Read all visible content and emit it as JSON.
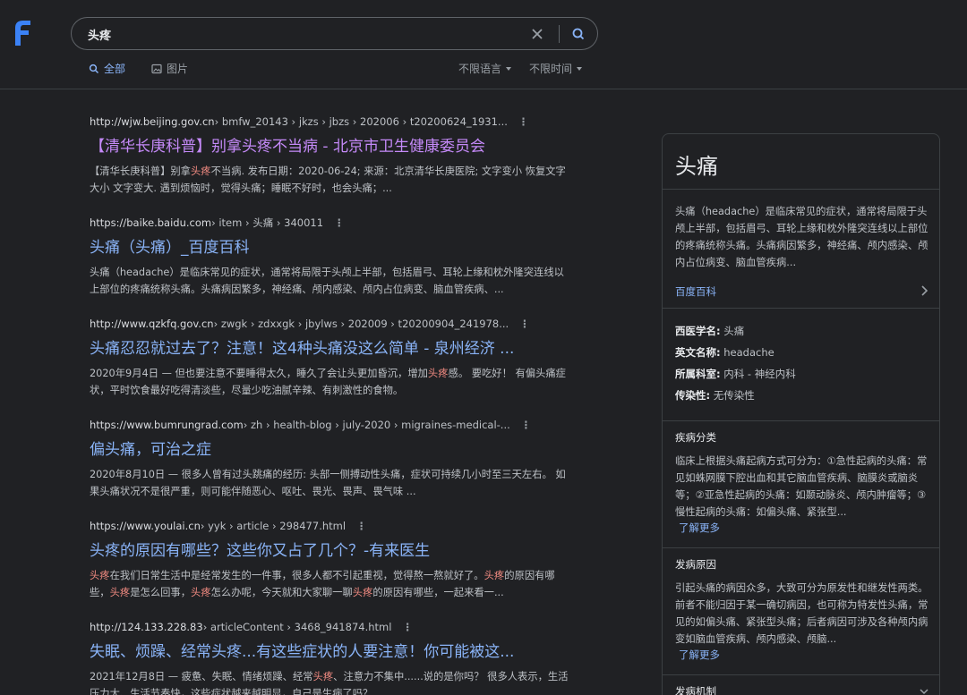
{
  "search": {
    "query": "头疼",
    "placeholder": ""
  },
  "tabs": [
    {
      "label": "全部",
      "icon": "search-icon",
      "active": true
    },
    {
      "label": "图片",
      "icon": "image-icon",
      "active": false
    }
  ],
  "filters": {
    "language": "不限语言",
    "time": "不限时间"
  },
  "colors": {
    "background": "#202124",
    "link": "#8ab4f8",
    "visited": "#c58af9",
    "highlight": "#f28b82",
    "logo": "#3b82f6"
  },
  "results": [
    {
      "host": "http://wjw.beijing.gov.cn",
      "path": " › bmfw_20143 › jkzs › jbzs › 202006 › t20200624_1931...",
      "title": "【清华长庚科普】别拿头疼不当病 - 北京市卫生健康委员会",
      "visited": true,
      "snippet": [
        {
          "t": "【清华长庚科普】别拿"
        },
        {
          "t": "头疼",
          "hl": true
        },
        {
          "t": "不当病. 发布日期：2020-06-24; 来源：北京清华长庚医院; 文字变小 恢复文字大小 文字变大. 遇到烦恼时，觉得头痛；睡眠不好时，也会头痛；..."
        }
      ]
    },
    {
      "host": "https://baike.baidu.com",
      "path": " › item › 头痛 › 340011",
      "title": "头痛（头痛）_百度百科",
      "visited": false,
      "snippet": [
        {
          "t": "头痛（headache）是临床常见的症状，通常将局限于头颅上半部，包括眉弓、耳轮上缘和枕外隆突连线以上部位的疼痛统称头痛。头痛病因繁多，神经痛、颅内感染、颅内占位病变、脑血管疾病、..."
        }
      ]
    },
    {
      "host": "http://www.qzkfq.gov.cn",
      "path": " › zwgk › zdxxgk › jbylws › 202009 › t20200904_241978...",
      "title": "头痛忍忍就过去了？注意！这4种头痛没这么简单 - 泉州经济 ...",
      "visited": false,
      "snippet": [
        {
          "t": "2020年9月4日 — 但也要注意不要睡得太久，睡久了会让头更加昏沉，增加"
        },
        {
          "t": "头疼",
          "hl": true
        },
        {
          "t": "感。 要吃好！ 有偏头痛症状，平时饮食最好吃得清淡些，尽量少吃油腻辛辣、有刺激性的食物。"
        }
      ]
    },
    {
      "host": "https://www.bumrungrad.com",
      "path": " › zh › health-blog › july-2020 › migraines-medical-...",
      "title": "偏头痛，可治之症",
      "visited": false,
      "snippet": [
        {
          "t": "2020年8月10日 — 很多人曾有过头跳痛的经历: 头部一侧搏动性头痛，症状可持续几小时至三天左右。 如果头痛状况不是很严重，则可能伴随恶心、呕吐、畏光、畏声、畏气味 ..."
        }
      ]
    },
    {
      "host": "https://www.youlai.cn",
      "path": " › yyk › article › 298477.html",
      "title": "头疼的原因有哪些？这些你又占了几个？-有来医生",
      "visited": false,
      "snippet": [
        {
          "t": "头疼",
          "hl": true
        },
        {
          "t": "在我们日常生活中是经常发生的一件事，很多人都不引起重视，觉得熬一熬就好了。"
        },
        {
          "t": "头疼",
          "hl": true
        },
        {
          "t": "的原因有哪些，"
        },
        {
          "t": "头疼",
          "hl": true
        },
        {
          "t": "是怎么回事，"
        },
        {
          "t": "头疼",
          "hl": true
        },
        {
          "t": "怎么办呢，今天就和大家聊一聊"
        },
        {
          "t": "头疼",
          "hl": true
        },
        {
          "t": "的原因有哪些，一起来看一..."
        }
      ]
    },
    {
      "host": "http://124.133.228.83",
      "path": " › articleContent › 3468_941874.html",
      "title": "失眠、烦躁、经常头疼...有这些症状的人要注意！你可能被这...",
      "visited": false,
      "snippet": [
        {
          "t": "2021年12月8日 — 疲惫、失眠、情绪烦躁、经常"
        },
        {
          "t": "头疼",
          "hl": true
        },
        {
          "t": "、注意力不集中......说的是你吗？ 很多人表示，生活压力大、生活节奏快，这些症状越来越明显，自己是生病了吗？"
        }
      ]
    }
  ],
  "knowledge_panel": {
    "title": "头痛",
    "description": "头痛（headache）是临床常见的症状，通常将局限于头颅上半部，包括眉弓、耳轮上缘和枕外隆突连线以上部位的疼痛统称头痛。头痛病因繁多，神经痛、颅内感染、颅内占位病变、脑血管疾病...",
    "source": "百度百科",
    "facts": [
      {
        "key": "西医学名:",
        "value": "头痛"
      },
      {
        "key": "英文名称:",
        "value": "headache"
      },
      {
        "key": "所属科室:",
        "value": "内科 - 神经内科"
      },
      {
        "key": "传染性:",
        "value": "无传染性"
      }
    ],
    "sections": [
      {
        "title": "疾病分类",
        "body": "临床上根据头痛起病方式可分为：①急性起病的头痛：常见如蛛网膜下腔出血和其它脑血管疾病、脑膜炎或脑炎等；②亚急性起病的头痛：如颞动脉炎、颅内肿瘤等；③慢性起病的头痛：如偏头痛、紧张型...",
        "more": "了解更多"
      },
      {
        "title": "发病原因",
        "body": "引起头痛的病因众多，大致可分为原发性和继发性两类。前者不能归因于某一确切病因，也可称为特发性头痛，常见的如偏头痛、紧张型头痛；后者病因可涉及各种颅内病变如脑血管疾病、颅内感染、颅脑...",
        "more": "了解更多"
      },
      {
        "title": "发病机制"
      }
    ]
  }
}
